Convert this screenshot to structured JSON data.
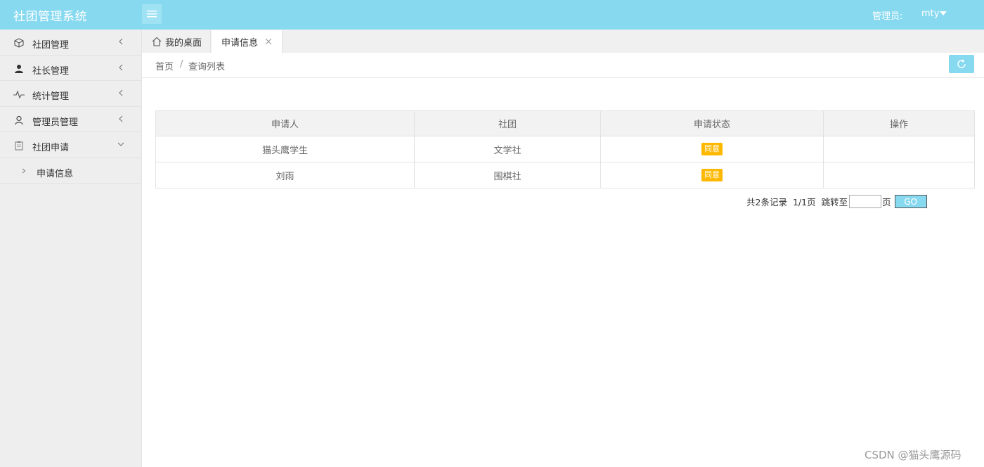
{
  "header": {
    "app_title": "社团管理系统",
    "admin_label": "管理员:",
    "admin_name": "mty",
    "bg_color": "#87d9f0"
  },
  "sidebar": {
    "items": [
      {
        "label": "社团管理",
        "icon": "cube-icon"
      },
      {
        "label": "社长管理",
        "icon": "user-icon"
      },
      {
        "label": "统计管理",
        "icon": "pulse-icon"
      },
      {
        "label": "管理员管理",
        "icon": "person-outline-icon"
      },
      {
        "label": "社团申请",
        "icon": "clipboard-icon"
      }
    ],
    "sub_items": [
      {
        "label": "申请信息"
      }
    ]
  },
  "tabs": {
    "home_label": "我的桌面",
    "active_label": "申请信息"
  },
  "breadcrumb": {
    "home": "首页",
    "separator": "/",
    "current": "查询列表"
  },
  "table": {
    "headers": [
      "申请人",
      "社团",
      "申请状态",
      "操作"
    ],
    "rows": [
      {
        "applicant": "猫头鹰学生",
        "club": "文学社",
        "status": "同意",
        "action": ""
      },
      {
        "applicant": "刘雨",
        "club": "围棋社",
        "status": "同意",
        "action": ""
      }
    ],
    "status_color": "#ffb800"
  },
  "pagination": {
    "total_text": "共2条记录",
    "page_text": "1/1页",
    "jump_text": "跳转至",
    "page_suffix": "页",
    "input_value": "",
    "go_label": "GO"
  },
  "watermark": "CSDN @猫头鹰源码"
}
